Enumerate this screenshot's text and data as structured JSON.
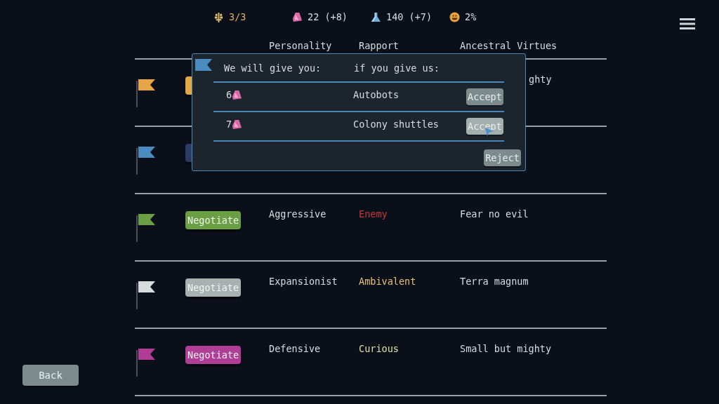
{
  "resources": [
    {
      "kind": "food",
      "text": "3/3",
      "color": "#e0b060"
    },
    {
      "kind": "gem",
      "text": "22 (+8)",
      "color": "#d8dde0"
    },
    {
      "kind": "flask",
      "text": "140 (+7)",
      "color": "#d8dde0"
    },
    {
      "kind": "mood",
      "text": "2%",
      "color": "#d8dde0"
    }
  ],
  "table": {
    "columns": [
      "Personality",
      "Rapport",
      "Ancestral Virtues"
    ],
    "rows": [
      {
        "color": "#e6a646",
        "button": {
          "color": "#e6a646"
        },
        "under_dialog": true,
        "ancestral_virtues": "ghty"
      },
      {
        "color": "#4a8cc0",
        "button": {
          "color": "#2c3a66"
        },
        "under_dialog": true
      },
      {
        "color": "#6aa043",
        "button": {
          "text": "Negotiate",
          "color": "#6aa043"
        },
        "under_dialog": false,
        "personality": "Aggressive",
        "rapport": {
          "text": "Enemy",
          "color": "#c8383c"
        },
        "ancestral_virtues": "Fear no evil"
      },
      {
        "color": "#d8dcdc",
        "button": {
          "text": "Negotiate",
          "color": "#a8b0b0"
        },
        "under_dialog": false,
        "personality": "Expansionist",
        "rapport": {
          "text": "Ambivalent",
          "color": "#e8c078"
        },
        "ancestral_virtues": "Terra magnum"
      },
      {
        "color": "#b03e96",
        "button": {
          "text": "Negotiate",
          "color": "#b03e96"
        },
        "under_dialog": false,
        "personality": "Defensive",
        "rapport": {
          "text": "Curious",
          "color": "#e0e0a4"
        },
        "ancestral_virtues": "Small but mighty"
      }
    ]
  },
  "dialog": {
    "color": "#4a8cc0",
    "give_heading": "We will give you:",
    "get_heading": "if you give us:",
    "offers": [
      {
        "amount": "6",
        "request": "Autobots",
        "button": "Accept",
        "hovered": false
      },
      {
        "amount": "7",
        "request": "Colony shuttles",
        "button": "Accept",
        "hovered": true
      }
    ],
    "reject": "Reject"
  },
  "back": "Back"
}
